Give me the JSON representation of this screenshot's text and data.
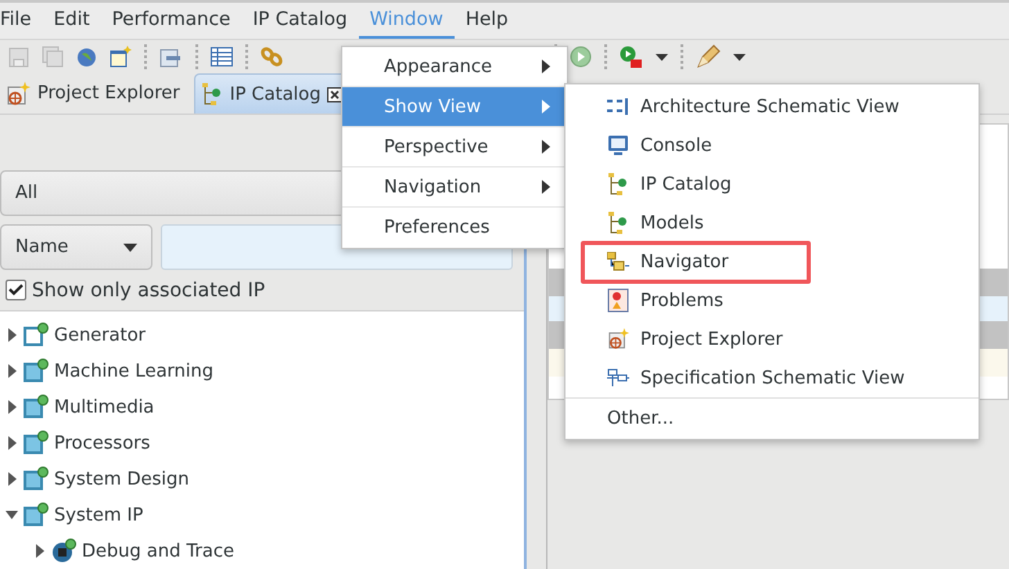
{
  "menu_bar": [
    {
      "label": "File",
      "selected": false
    },
    {
      "label": "Edit",
      "selected": false
    },
    {
      "label": "Performance",
      "selected": false
    },
    {
      "label": "IP Catalog",
      "selected": false
    },
    {
      "label": "Window",
      "selected": true
    },
    {
      "label": "Help",
      "selected": false
    }
  ],
  "view_tabs": [
    {
      "label": "Project Explorer",
      "selected": false,
      "closable": false
    },
    {
      "label": "IP Catalog",
      "selected": true,
      "closable": true
    }
  ],
  "filter": {
    "category": "All",
    "field": "Name"
  },
  "show_only_associated": {
    "label": "Show only associated IP",
    "checked": true
  },
  "tree": [
    {
      "label": "Generator",
      "expanded": false,
      "kind": "generator"
    },
    {
      "label": "Machine Learning",
      "expanded": false,
      "kind": "category"
    },
    {
      "label": "Multimedia",
      "expanded": false,
      "kind": "category"
    },
    {
      "label": "Processors",
      "expanded": false,
      "kind": "category"
    },
    {
      "label": "System Design",
      "expanded": false,
      "kind": "category"
    },
    {
      "label": "System IP",
      "expanded": true,
      "kind": "category",
      "children": [
        {
          "label": "Debug and Trace",
          "expanded": false,
          "kind": "chip"
        }
      ]
    }
  ],
  "window_menu": [
    {
      "label": "Appearance",
      "submenu": true,
      "selected": false
    },
    {
      "label": "Show View",
      "submenu": true,
      "selected": true
    },
    {
      "label": "Perspective",
      "submenu": true,
      "selected": false
    },
    {
      "label": "Navigation",
      "submenu": true,
      "selected": false
    },
    {
      "label": "Preferences",
      "submenu": false,
      "selected": false
    }
  ],
  "show_view_menu": [
    {
      "label": "Architecture Schematic View",
      "kind": "schematic",
      "highlighted": false
    },
    {
      "label": "Console",
      "kind": "console",
      "highlighted": false
    },
    {
      "label": "IP Catalog",
      "kind": "catalog",
      "highlighted": false
    },
    {
      "label": "Models",
      "kind": "catalog",
      "highlighted": false
    },
    {
      "label": "Navigator",
      "kind": "navigator",
      "highlighted": true
    },
    {
      "label": "Problems",
      "kind": "problems",
      "highlighted": false
    },
    {
      "label": "Project Explorer",
      "kind": "explorer",
      "highlighted": false
    },
    {
      "label": "Specification Schematic View",
      "kind": "spec",
      "highlighted": false
    },
    {
      "label": "Other...",
      "kind": "plain"
    }
  ]
}
